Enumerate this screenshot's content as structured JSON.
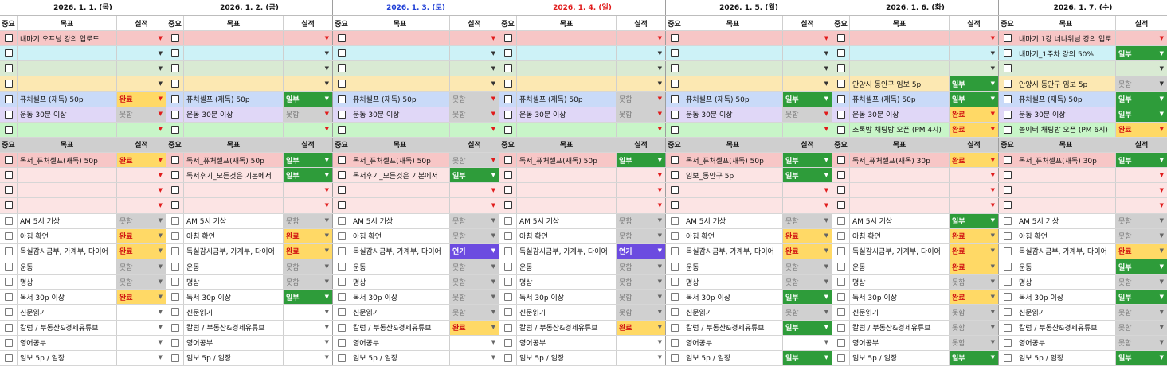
{
  "colors": {
    "wan": "#ffd966",
    "il": "#2e9c3a",
    "mot": "#d0d0d0",
    "yeon": "#6c4be0",
    "saturday": "#1f3fd6",
    "sunday": "#e01b1b"
  },
  "headers": {
    "imp": "중요",
    "goal": "목표",
    "res": "실적"
  },
  "days": [
    {
      "date": "2026. 1. 1. (목)",
      "color": "#111",
      "top": [
        {
          "goal": "내마기 오프닝 강의 업로드",
          "res": ""
        },
        {
          "goal": "",
          "res": ""
        },
        {
          "goal": "",
          "res": ""
        },
        {
          "goal": "",
          "res": ""
        },
        {
          "goal": "퓨처셀프 (재독) 50p",
          "res": "완료"
        },
        {
          "goal": "운동 30분 이상",
          "res": "못함"
        },
        {
          "goal": "",
          "res": ""
        }
      ],
      "mid": [
        {
          "goal": "독서_퓨처셀프(재독) 50p",
          "res": "완료"
        },
        {
          "goal": "",
          "res": ""
        },
        {
          "goal": "",
          "res": ""
        },
        {
          "goal": "",
          "res": ""
        }
      ],
      "low": [
        {
          "goal": "AM 5시 기상",
          "res": "못함"
        },
        {
          "goal": "아침 확언",
          "res": "완료"
        },
        {
          "goal": "독실감시금부, 가계부, 다이어",
          "res": "완료"
        },
        {
          "goal": "운동",
          "res": "못함"
        },
        {
          "goal": "명상",
          "res": "못함"
        },
        {
          "goal": "독서 30p 이상",
          "res": "완료"
        },
        {
          "goal": "신문읽기",
          "res": ""
        },
        {
          "goal": "칼럼 / 부동산&경제유튜브",
          "res": ""
        },
        {
          "goal": "영어공부",
          "res": ""
        },
        {
          "goal": "임보 5p / 임장",
          "res": ""
        }
      ]
    },
    {
      "date": "2026. 1. 2. (금)",
      "color": "#111",
      "top": [
        {
          "goal": "",
          "res": ""
        },
        {
          "goal": "",
          "res": ""
        },
        {
          "goal": "",
          "res": ""
        },
        {
          "goal": "",
          "res": ""
        },
        {
          "goal": "퓨처셀프 (재독) 50p",
          "res": "일부"
        },
        {
          "goal": "운동 30분 이상",
          "res": "못함"
        },
        {
          "goal": "",
          "res": ""
        }
      ],
      "mid": [
        {
          "goal": "독서_퓨처셀프(재독) 50p",
          "res": "일부"
        },
        {
          "goal": "독서후기_모든것은 기본에서",
          "res": "일부"
        },
        {
          "goal": "",
          "res": ""
        },
        {
          "goal": "",
          "res": ""
        }
      ],
      "low": [
        {
          "goal": "AM 5시 기상",
          "res": "못함"
        },
        {
          "goal": "아침 확언",
          "res": "완료"
        },
        {
          "goal": "독실감시금부, 가계부, 다이어",
          "res": "완료"
        },
        {
          "goal": "운동",
          "res": "못함"
        },
        {
          "goal": "명상",
          "res": "못함"
        },
        {
          "goal": "독서 30p 이상",
          "res": "일부"
        },
        {
          "goal": "신문읽기",
          "res": ""
        },
        {
          "goal": "칼럼 / 부동산&경제유튜브",
          "res": ""
        },
        {
          "goal": "영어공부",
          "res": ""
        },
        {
          "goal": "임보 5p / 임장",
          "res": ""
        }
      ]
    },
    {
      "date": "2026. 1. 3. (토)",
      "color": "#1f3fd6",
      "top": [
        {
          "goal": "",
          "res": ""
        },
        {
          "goal": "",
          "res": ""
        },
        {
          "goal": "",
          "res": ""
        },
        {
          "goal": "",
          "res": ""
        },
        {
          "goal": "퓨처셀프 (재독) 50p",
          "res": "못함"
        },
        {
          "goal": "운동 30분 이상",
          "res": "못함"
        },
        {
          "goal": "",
          "res": ""
        }
      ],
      "mid": [
        {
          "goal": "독서_퓨처셀프(재독) 50p",
          "res": "못함"
        },
        {
          "goal": "독서후기_모든것은 기본에서",
          "res": "일부"
        },
        {
          "goal": "",
          "res": ""
        },
        {
          "goal": "",
          "res": ""
        }
      ],
      "low": [
        {
          "goal": "AM 5시 기상",
          "res": "못함"
        },
        {
          "goal": "아침 확언",
          "res": "못함"
        },
        {
          "goal": "독실감시금부, 가계부, 다이어",
          "res": "연기"
        },
        {
          "goal": "운동",
          "res": "못함"
        },
        {
          "goal": "명상",
          "res": "못함"
        },
        {
          "goal": "독서 30p 이상",
          "res": "못함"
        },
        {
          "goal": "신문읽기",
          "res": "못함"
        },
        {
          "goal": "칼럼 / 부동산&경제유튜브",
          "res": "완료"
        },
        {
          "goal": "영어공부",
          "res": ""
        },
        {
          "goal": "임보 5p / 임장",
          "res": ""
        }
      ]
    },
    {
      "date": "2026. 1. 4. (일)",
      "color": "#e01b1b",
      "top": [
        {
          "goal": "",
          "res": ""
        },
        {
          "goal": "",
          "res": ""
        },
        {
          "goal": "",
          "res": ""
        },
        {
          "goal": "",
          "res": ""
        },
        {
          "goal": "퓨처셀프 (재독) 50p",
          "res": "못함"
        },
        {
          "goal": "운동 30분 이상",
          "res": "못함"
        },
        {
          "goal": "",
          "res": ""
        }
      ],
      "mid": [
        {
          "goal": "독서_퓨처셀프(재독) 50p",
          "res": "일부"
        },
        {
          "goal": "",
          "res": ""
        },
        {
          "goal": "",
          "res": ""
        },
        {
          "goal": "",
          "res": ""
        }
      ],
      "low": [
        {
          "goal": "AM 5시 기상",
          "res": "못함"
        },
        {
          "goal": "아침 확언",
          "res": "못함"
        },
        {
          "goal": "독실감시금부, 가계부, 다이어",
          "res": "연기"
        },
        {
          "goal": "운동",
          "res": "못함"
        },
        {
          "goal": "명상",
          "res": "못함"
        },
        {
          "goal": "독서 30p 이상",
          "res": "못함"
        },
        {
          "goal": "신문읽기",
          "res": "못함"
        },
        {
          "goal": "칼럼 / 부동산&경제유튜브",
          "res": "완료"
        },
        {
          "goal": "영어공부",
          "res": ""
        },
        {
          "goal": "임보 5p / 임장",
          "res": ""
        }
      ]
    },
    {
      "date": "2026. 1. 5. (월)",
      "color": "#111",
      "top": [
        {
          "goal": "",
          "res": ""
        },
        {
          "goal": "",
          "res": ""
        },
        {
          "goal": "",
          "res": ""
        },
        {
          "goal": "",
          "res": ""
        },
        {
          "goal": "퓨처셀프 (재독) 50p",
          "res": "일부"
        },
        {
          "goal": "운동 30분 이상",
          "res": "못함"
        },
        {
          "goal": "",
          "res": ""
        }
      ],
      "mid": [
        {
          "goal": "독서_퓨처셀프(재독) 50p",
          "res": "일부"
        },
        {
          "goal": "임보_동안구 5p",
          "res": "일부"
        },
        {
          "goal": "",
          "res": ""
        },
        {
          "goal": "",
          "res": ""
        }
      ],
      "low": [
        {
          "goal": "AM 5시 기상",
          "res": "못함"
        },
        {
          "goal": "아침 확언",
          "res": "완료"
        },
        {
          "goal": "독실감시금부, 가계부, 다이어",
          "res": "완료"
        },
        {
          "goal": "운동",
          "res": "못함"
        },
        {
          "goal": "명상",
          "res": "못함"
        },
        {
          "goal": "독서 30p 이상",
          "res": "일부"
        },
        {
          "goal": "신문읽기",
          "res": "못함"
        },
        {
          "goal": "칼럼 / 부동산&경제유튜브",
          "res": "일부"
        },
        {
          "goal": "영어공부",
          "res": ""
        },
        {
          "goal": "임보 5p / 임장",
          "res": "일부"
        }
      ]
    },
    {
      "date": "2026. 1. 6. (화)",
      "color": "#111",
      "top": [
        {
          "goal": "",
          "res": ""
        },
        {
          "goal": "",
          "res": ""
        },
        {
          "goal": "",
          "res": ""
        },
        {
          "goal": "안양시 동안구 임보 5p",
          "res": "일부"
        },
        {
          "goal": "퓨처셀프 (재독) 50p",
          "res": "일부"
        },
        {
          "goal": "운동 30분 이상",
          "res": "완료"
        },
        {
          "goal": "조톡방 채팅방 오픈 (PM 4시)",
          "res": "완료"
        }
      ],
      "mid": [
        {
          "goal": "독서_퓨처셀프(재독) 30p",
          "res": "완료"
        },
        {
          "goal": "",
          "res": ""
        },
        {
          "goal": "",
          "res": ""
        },
        {
          "goal": "",
          "res": ""
        }
      ],
      "low": [
        {
          "goal": "AM 5시 기상",
          "res": "일부"
        },
        {
          "goal": "아침 확언",
          "res": "완료"
        },
        {
          "goal": "독실감시금부, 가계부, 다이어",
          "res": "완료"
        },
        {
          "goal": "운동",
          "res": "완료"
        },
        {
          "goal": "명상",
          "res": "못함"
        },
        {
          "goal": "독서 30p 이상",
          "res": "완료"
        },
        {
          "goal": "신문읽기",
          "res": "못함"
        },
        {
          "goal": "칼럼 / 부동산&경제유튜브",
          "res": "못함"
        },
        {
          "goal": "영어공부",
          "res": "못함"
        },
        {
          "goal": "임보 5p / 임장",
          "res": "일부"
        }
      ]
    },
    {
      "date": "2026. 1. 7. (수)",
      "color": "#111",
      "top": [
        {
          "goal": "내마기 1강 너나위님 강의 업로",
          "res": ""
        },
        {
          "goal": "내마기_1주차 강의 50%",
          "res": "일부"
        },
        {
          "goal": "",
          "res": ""
        },
        {
          "goal": "안양시 동안구 임보 5p",
          "res": "못함"
        },
        {
          "goal": "퓨처셀프 (재독) 50p",
          "res": "일부"
        },
        {
          "goal": "운동 30분 이상",
          "res": "일부"
        },
        {
          "goal": "놀이터 채팅방 오픈 (PM 6시)",
          "res": "완료"
        }
      ],
      "mid": [
        {
          "goal": "독서_퓨처셀프(재독) 30p",
          "res": "일부"
        },
        {
          "goal": "",
          "res": ""
        },
        {
          "goal": "",
          "res": ""
        },
        {
          "goal": "",
          "res": ""
        }
      ],
      "low": [
        {
          "goal": "AM 5시 기상",
          "res": "못함"
        },
        {
          "goal": "아침 확언",
          "res": "못함"
        },
        {
          "goal": "독실감시금부, 가계부, 다이어",
          "res": "완료"
        },
        {
          "goal": "운동",
          "res": "일부"
        },
        {
          "goal": "명상",
          "res": "못함"
        },
        {
          "goal": "독서 30p 이상",
          "res": "일부"
        },
        {
          "goal": "신문읽기",
          "res": "못함"
        },
        {
          "goal": "칼럼 / 부동산&경제유튜브",
          "res": "못함"
        },
        {
          "goal": "영어공부",
          "res": "못함"
        },
        {
          "goal": "임보 5p / 임장",
          "res": "일부"
        }
      ]
    }
  ]
}
